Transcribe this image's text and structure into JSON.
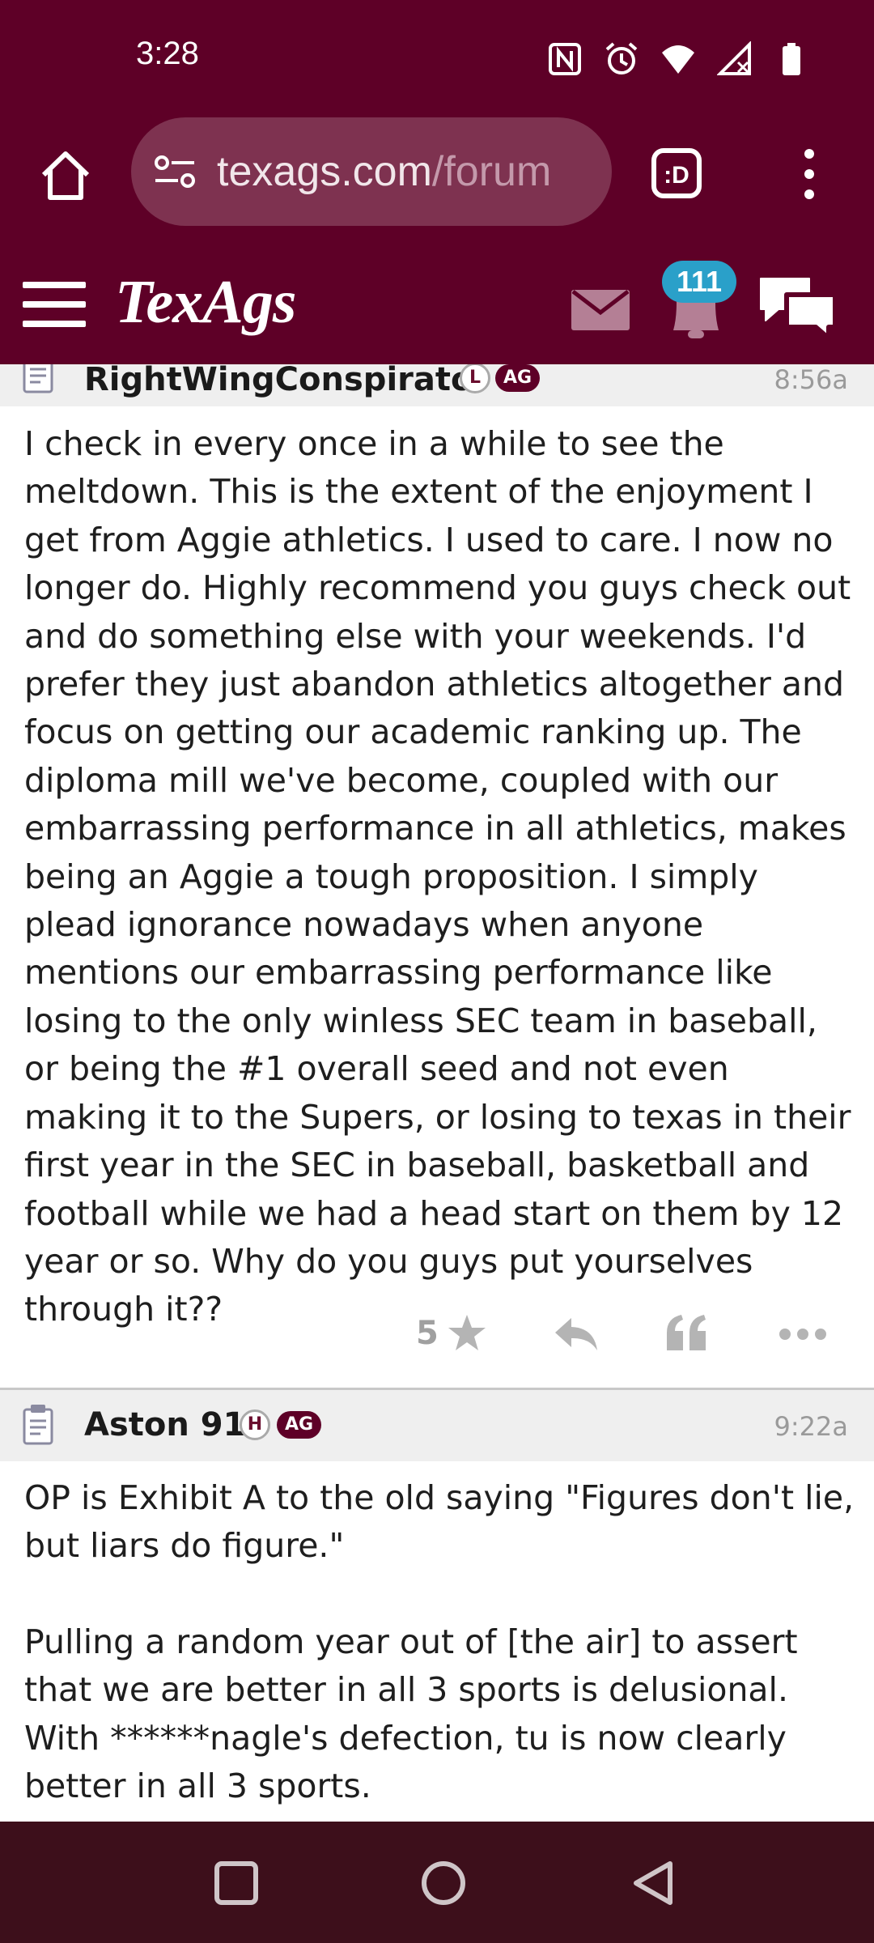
{
  "status_bar": {
    "time": "3:28",
    "icons": [
      "nfc-icon",
      "alarm-icon",
      "wifi-icon",
      "signal-icon",
      "battery-icon"
    ]
  },
  "browser": {
    "url_main": "texags.com",
    "url_rest": "/forum",
    "tab_label": ":D"
  },
  "site_header": {
    "logo": "TexAgs",
    "notifications_count": "111"
  },
  "posts": [
    {
      "username": "RightWingConspirator",
      "badge_letter": "L",
      "badge_ag": "AG",
      "time": "8:56a",
      "paragraphs": [
        "I check in every once in a while to see the meltdown. This is the extent of the enjoyment I get from Aggie athletics. I used to care. I now no longer do. Highly recommend you guys check out and do something else with your weekends. I'd prefer they just abandon athletics altogether and focus on getting our academic ranking up. The diploma mill we've become, coupled with our embarrassing performance in all athletics, makes being an Aggie a tough proposition. I simply plead ignorance nowadays when anyone mentions our embarrassing performance like losing to the only winless SEC team in baseball, or being the #1 overall seed and not even making it to the Supers, or losing to texas in their first year in the SEC in baseball, basketball and football while we had a head start on them by 12 year or so. Why do you guys put yourselves through it??"
      ],
      "star_count": "5"
    },
    {
      "username": "Aston 91",
      "badge_letter": "H",
      "badge_ag": "AG",
      "time": "9:22a",
      "paragraphs": [
        "OP is Exhibit A to the old saying \"Figures don't lie, but liars do figure.\"",
        "Pulling a random year out of [the air] to assert that we are better in all 3 sports is delusional. With ******nagle's defection, tu is now clearly better in all 3 sports."
      ]
    }
  ],
  "colors": {
    "brand_maroon": "#5e0027",
    "nav_bar": "#3d0f1b",
    "badge_blue": "#2aa0c9"
  }
}
